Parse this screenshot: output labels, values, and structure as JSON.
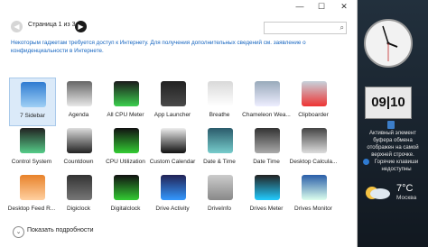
{
  "window": {
    "minimize_glyph": "—",
    "maximize_glyph": "☐",
    "close_glyph": "✕",
    "page_label": "Страница 1 из 3",
    "search": {
      "value": "",
      "placeholder": ""
    },
    "info_text": "Некоторым гаджетам требуется доступ к Интернету. Для получения дополнительных сведений см. заявление о конфиденциальности в Интернете.",
    "footer_label": "Показать подробности"
  },
  "gadgets": [
    {
      "label": "7 Sidebar",
      "icon": "monitor-icon"
    },
    {
      "label": "Agenda",
      "icon": "agenda-icon"
    },
    {
      "label": "All CPU Meter",
      "icon": "cpu-meter-icon"
    },
    {
      "label": "App Launcher",
      "icon": "app-launcher-icon"
    },
    {
      "label": "Breathe",
      "icon": "breathe-icon"
    },
    {
      "label": "Chameleon Wea...",
      "icon": "weather-cloud-icon"
    },
    {
      "label": "Clipboarder",
      "icon": "clipboard-icon"
    },
    {
      "label": "Control System",
      "icon": "control-system-icon"
    },
    {
      "label": "Countdown",
      "icon": "calendar-7-icon"
    },
    {
      "label": "CPU Utilization",
      "icon": "cpu-utilization-icon"
    },
    {
      "label": "Custom Calendar",
      "icon": "calendar-8-icon"
    },
    {
      "label": "Date & Time",
      "icon": "date-time-icon"
    },
    {
      "label": "Date Time",
      "icon": "date-time-icon-2"
    },
    {
      "label": "Desktop Calcula...",
      "icon": "calculator-icon"
    },
    {
      "label": "Desktop Feed R...",
      "icon": "rss-icon"
    },
    {
      "label": "Digiclock",
      "icon": "digiclock-icon"
    },
    {
      "label": "Digitalclock",
      "icon": "digitalclock-icon"
    },
    {
      "label": "Drive Activity",
      "icon": "drive-activity-icon"
    },
    {
      "label": "DriveInfo",
      "icon": "drive-info-icon"
    },
    {
      "label": "Drives Meter",
      "icon": "drives-meter-icon"
    },
    {
      "label": "Drives Monitor",
      "icon": "drives-monitor-icon"
    }
  ],
  "sidebar": {
    "calendar_time": "09|10",
    "clipboard_text": "Активный элемент буфера обмена отображен на самой верхней строчке.",
    "hotkeys_text": "Горячие клавиши недоступны",
    "weather_temp": "7°C",
    "weather_city": "Москва"
  },
  "colors": {
    "accent": "#1565c0",
    "selection": "#dbeaf9",
    "sidebar_bg": "#1a232c"
  }
}
